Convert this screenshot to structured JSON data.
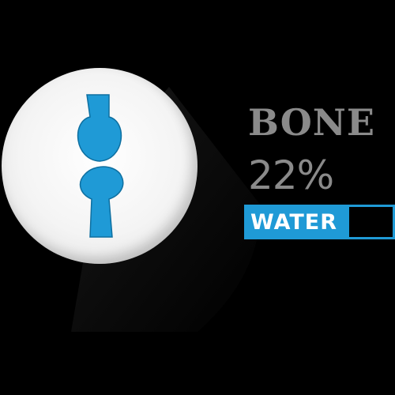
{
  "colors": {
    "background": "#000000",
    "bone": "#1f9ad6",
    "bone_outline": "#0e6fa0",
    "text_gray": "#8a8a8a",
    "bar_border": "#1f9ad6",
    "bar_fill": "#1f9ad6",
    "bar_empty": "#000000"
  },
  "icon": {
    "name": "bone-joint-icon"
  },
  "stat": {
    "title": "BONE",
    "percent": "22%",
    "bar_label": "WATER",
    "level": 0.7
  }
}
